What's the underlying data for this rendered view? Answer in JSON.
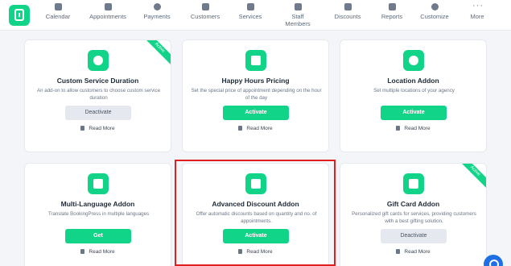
{
  "nav": {
    "items": [
      {
        "label": "Calendar",
        "icon": "calendar-icon"
      },
      {
        "label": "Appointments",
        "icon": "appointments-icon"
      },
      {
        "label": "Payments",
        "icon": "payments-icon"
      },
      {
        "label": "Customers",
        "icon": "customers-icon"
      },
      {
        "label": "Services",
        "icon": "services-icon"
      },
      {
        "label": "Staff Members",
        "icon": "staff-icon"
      },
      {
        "label": "Discounts",
        "icon": "discount-tag-icon"
      },
      {
        "label": "Reports",
        "icon": "reports-icon"
      },
      {
        "label": "Customize",
        "icon": "palette-icon"
      },
      {
        "label": "More",
        "icon": "more-dots-icon"
      }
    ]
  },
  "addons": [
    {
      "title": "Custom Service Duration",
      "description": "An add-on to allow customers to choose custom service duration",
      "button": "Deactivate",
      "read_more": "Read More",
      "badge": "Active",
      "icon": "clock-plus-icon"
    },
    {
      "title": "Happy Hours Pricing",
      "description": "Set the special price of appointment depending on the hour of the day",
      "button": "Activate",
      "read_more": "Read More",
      "icon": "hourglass-percent-icon"
    },
    {
      "title": "Location Addon",
      "description": "Set multiple locations of your agency",
      "button": "Activate",
      "read_more": "Read More",
      "icon": "location-pin-icon"
    },
    {
      "title": "Multi-Language Addon",
      "description": "Translate BookingPress in multiple languages",
      "button": "Get",
      "read_more": "Read More",
      "icon": "translate-icon"
    },
    {
      "title": "Advanced Discount Addon",
      "description": "Offer automatic discounts based on quantity and no. of appointments.",
      "button": "Activate",
      "read_more": "Read More",
      "icon": "discount-tag-icon"
    },
    {
      "title": "Gift Card Addon",
      "description": "Personalized gift cards for services, providing customers with a best gifting solution.",
      "button": "Deactivate",
      "read_more": "Read More",
      "badge": "Active",
      "icon": "gift-card-icon"
    }
  ],
  "colors": {
    "accent": "#12d488",
    "highlight": "#e02020"
  }
}
